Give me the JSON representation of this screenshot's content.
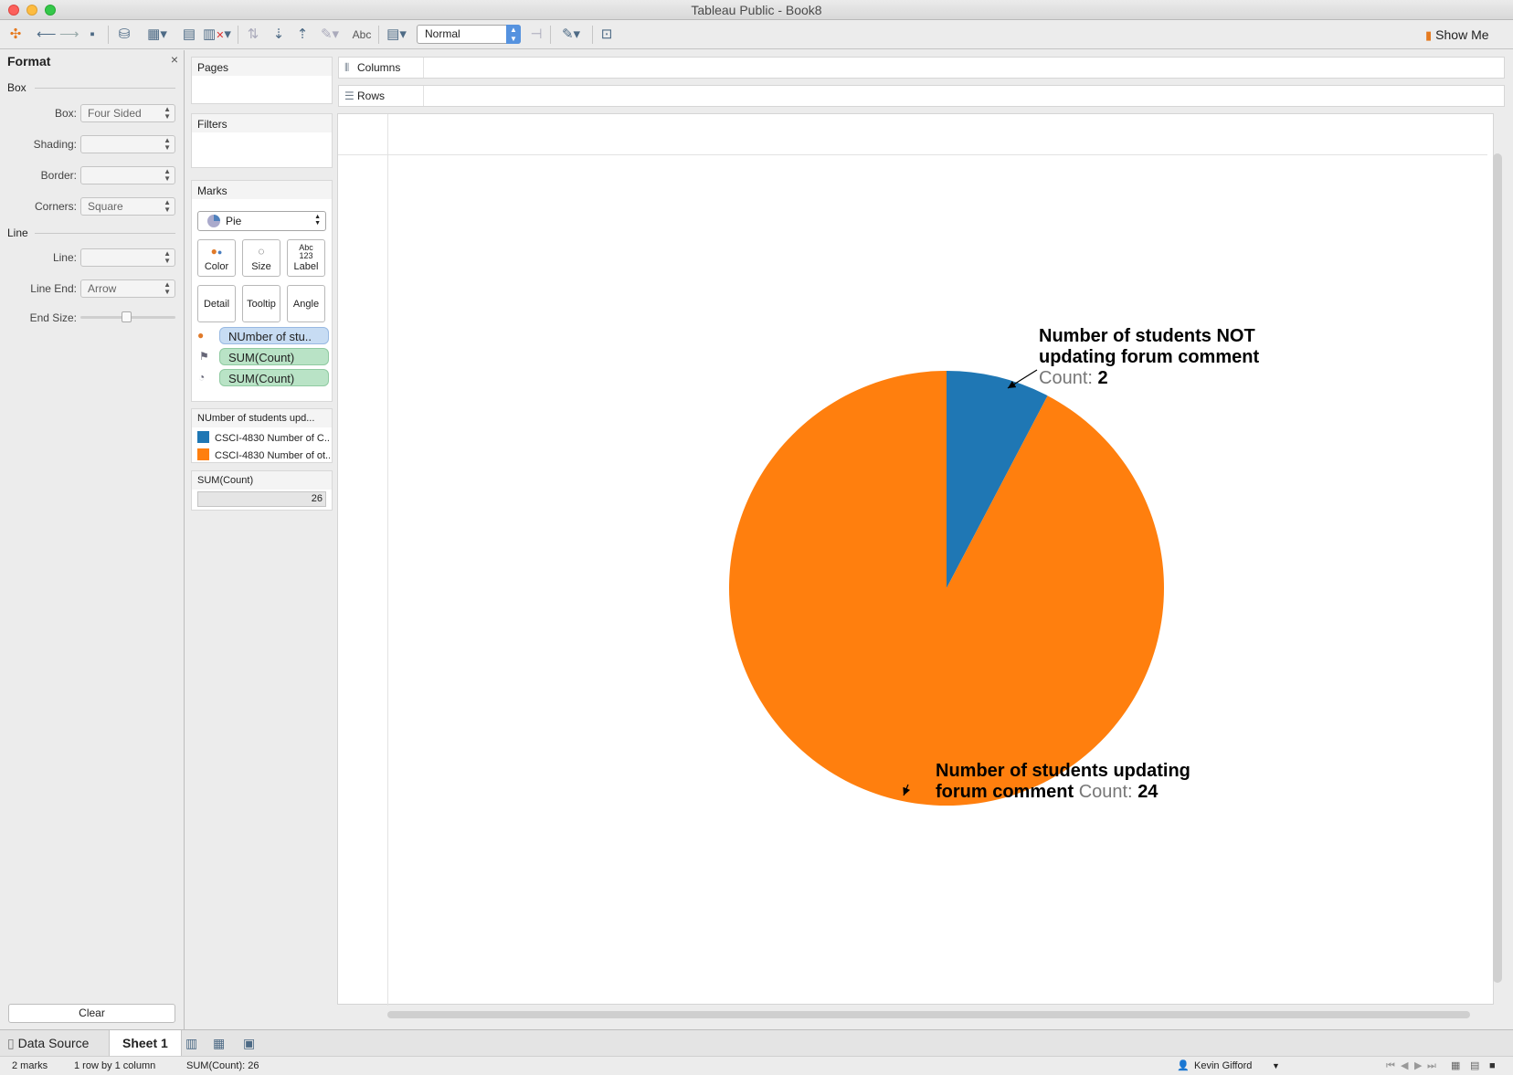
{
  "window": {
    "title": "Tableau Public - Book8"
  },
  "colors": {
    "blue": "#1f77b4",
    "orange": "#ff7f0e",
    "close": "#fc605b",
    "minimize": "#fdbc40",
    "zoom": "#34c84a"
  },
  "toolbar": {
    "icons": [
      "tableau-logo-icon",
      "undo-icon",
      "redo-icon",
      "save-icon",
      "new-datasource-icon",
      "new-worksheet-icon",
      "duplicate-icon",
      "clear-sheet-icon",
      "swap-icon",
      "sort-asc-icon",
      "sort-desc-icon",
      "highlight-icon",
      "labels-icon",
      "fit-icon",
      "pin-icon",
      "pen-icon",
      "presentation-icon"
    ],
    "labels_button": "Abc",
    "fit_select": "Normal",
    "show_me": "Show Me"
  },
  "format": {
    "title": "Format",
    "close": "×",
    "box_section": "Box",
    "line_section": "Line",
    "rows": [
      {
        "label": "Box:",
        "value": "Four Sided"
      },
      {
        "label": "Shading:",
        "value": ""
      },
      {
        "label": "Border:",
        "value": ""
      },
      {
        "label": "Corners:",
        "value": "Square"
      },
      {
        "label": "Line:",
        "value": ""
      },
      {
        "label": "Line End:",
        "value": "Arrow"
      }
    ],
    "end_size_label": "End Size:",
    "end_size_level": 0.5,
    "clear": "Clear"
  },
  "cards": {
    "pages": "Pages",
    "filters": "Filters",
    "marks": "Marks",
    "mark_type": "Pie",
    "buttons": [
      {
        "label": "Color",
        "icon": "Color"
      },
      {
        "label": "Size",
        "icon": "Size"
      },
      {
        "label": "Label",
        "icon": "Abc 123"
      },
      {
        "label": "Detail",
        "icon": ""
      },
      {
        "label": "Tooltip",
        "icon": ""
      },
      {
        "label": "Angle",
        "icon": ""
      }
    ],
    "pills": [
      {
        "text": "NUmber of stu..",
        "type": "dimension"
      },
      {
        "text": "SUM(Count)",
        "type": "measure"
      },
      {
        "text": "SUM(Count)",
        "type": "measure"
      }
    ],
    "legend_title": "NUmber of students upd...",
    "legend_items": [
      "CSCI-4830 Number of C...",
      "CSCI-4830 Number of ot..."
    ],
    "size_title": "SUM(Count)",
    "size_value": "26"
  },
  "shelves": {
    "columns": "Columns",
    "rows": "Rows"
  },
  "chart_data": {
    "type": "pie",
    "categories": [
      "Number of students NOT updating forum comment",
      "Number of students updating forum comment"
    ],
    "values": [
      2,
      24
    ],
    "colors": [
      "#1f77b4",
      "#ff7f0e"
    ],
    "labels": [
      {
        "line1": "Number of students NOT",
        "line2": "updating forum comment",
        "count_prefix": "Count:",
        "count": "2"
      },
      {
        "line1": "Number of students updating",
        "line2": "forum comment",
        "count_prefix": "Count:",
        "count": "24"
      }
    ]
  },
  "tabs": {
    "data_source": "Data Source",
    "sheet": "Sheet 1"
  },
  "status": {
    "marks": "2 marks",
    "dims": "1 row by 1 column",
    "sum": "SUM(Count): 26",
    "user": "Kevin Gifford"
  }
}
